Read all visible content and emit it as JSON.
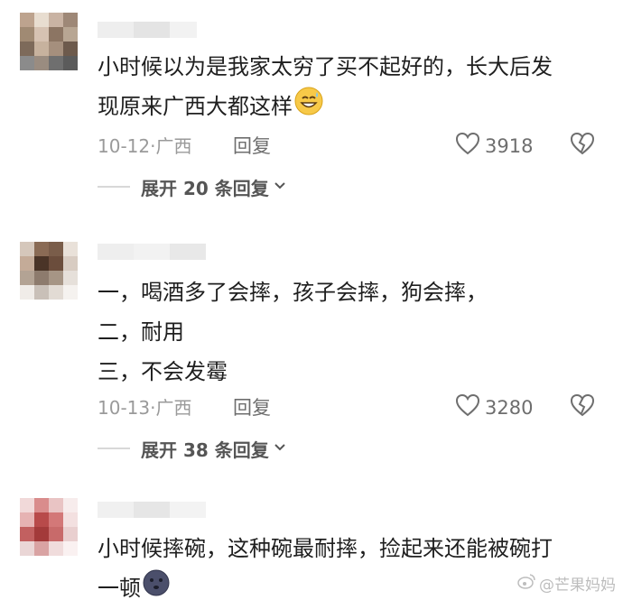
{
  "comments": [
    {
      "lines": [
        "小时候以为是我家太穷了买不起好的，长大后发",
        "现原来广西大都这样"
      ],
      "emoji": "grinning-face-with-sweat",
      "date": "10-12",
      "location": "广西",
      "reply_label": "回复",
      "likes": "3918",
      "expand_label": "展开 20 条回复",
      "avatar_colors": [
        "#bda38e",
        "#e8ddd0",
        "#c9b3a3",
        "#9e8877",
        "#a08a73",
        "#d6c2b2",
        "#8c7563",
        "#b8a693",
        "#7d6a5a",
        "#c7b29e",
        "#a58f7d",
        "#6d5a4c",
        "#8b8b8b",
        "#9a8c80",
        "#6f6f6f",
        "#5b5b5b"
      ]
    },
    {
      "lines": [
        "一，喝酒多了会摔，孩子会摔，狗会摔，",
        "二，耐用",
        "三，不会发霉"
      ],
      "date": "10-13",
      "location": "广西",
      "reply_label": "回复",
      "likes": "3280",
      "expand_label": "展开 38 条回复",
      "avatar_colors": [
        "#d5c7bb",
        "#8a6b55",
        "#7a5d4a",
        "#e9e1d9",
        "#c4ab98",
        "#4a3427",
        "#6b4d3c",
        "#d8ccc2",
        "#b3a394",
        "#8d7b6d",
        "#a69585",
        "#e6e0da",
        "#f0ece8",
        "#c9c0b8",
        "#e2dbd4",
        "#f5f2ef"
      ]
    },
    {
      "lines": [
        "小时候摔碗，这种碗最耐摔，捡起来还能被碗打",
        "一顿"
      ],
      "emoji": "dark-face",
      "avatar_colors": [
        "#f1d9d9",
        "#d98c8c",
        "#e9c4c4",
        "#f7ecec",
        "#e6b3b3",
        "#b84a4a",
        "#d37878",
        "#f3e0e0",
        "#c26060",
        "#a33a3a",
        "#c86a6a",
        "#e9cfcf",
        "#ead6d6",
        "#d9a3a3",
        "#f0dcdc",
        "#faf1f1"
      ]
    }
  ],
  "watermark": "@芒果妈妈",
  "colors": {
    "text": "#1f1f1f",
    "meta": "#9a9a9a",
    "icon": "#6e6e6e"
  }
}
